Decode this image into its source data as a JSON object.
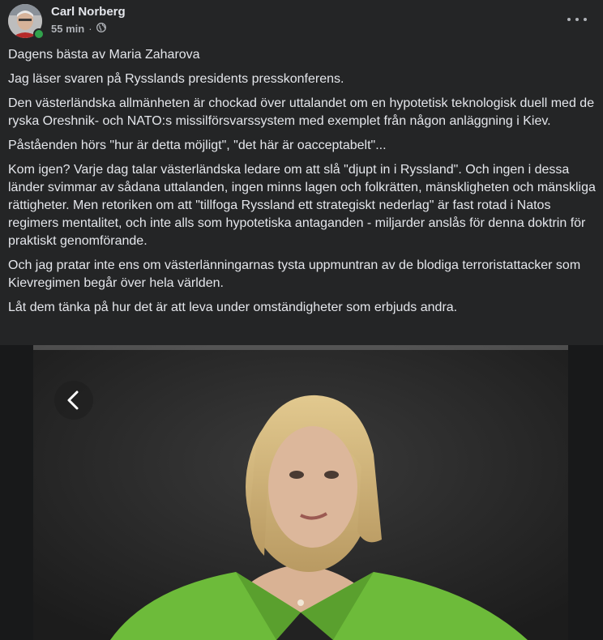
{
  "post": {
    "author": "Carl Norberg",
    "time": "55 min",
    "separator": "·",
    "audience_icon": "globe-icon",
    "more_icon": "more-options-icon",
    "paragraphs": [
      "Dagens bästa av Maria Zaharova",
      "Jag läser svaren på Rysslands presidents presskonferens.",
      "Den västerländska allmänheten är chockad över uttalandet om en hypotetisk teknologisk duell med de ryska Oreshnik- och NATO:s missilförsvarssystem med exemplet från någon anläggning i Kiev.",
      "Påståenden hörs \"hur är detta möjligt\", \"det här är oacceptabelt\"...",
      "Kom igen? Varje dag talar västerländska ledare om att slå \"djupt in i Ryssland\". Och ingen i dessa länder svimmar av sådana uttalanden, ingen minns lagen och folkrätten, mänskligheten och mänskliga rättigheter. Men retoriken om att \"tillfoga Ryssland ett strategiskt nederlag\" är fast rotad i Natos regimers mentalitet, och inte alls som hypotetiska antaganden - miljarder anslås för denna doktrin för praktiskt genomförande.",
      "Och jag pratar inte ens om västerlänningarnas tysta uppmuntran av de blodiga terroristattacker som Kievregimen begår över hela världen.",
      "Låt dem tänka på hur det är att leva under omständigheter som erbjuds andra."
    ]
  },
  "photo": {
    "back_icon": "chevron-left-icon"
  },
  "colors": {
    "background": "#242526",
    "text": "#e4e6eb",
    "secondary_text": "#b0b3b8",
    "online": "#31a24c",
    "jacket": "#6dbb3a"
  }
}
